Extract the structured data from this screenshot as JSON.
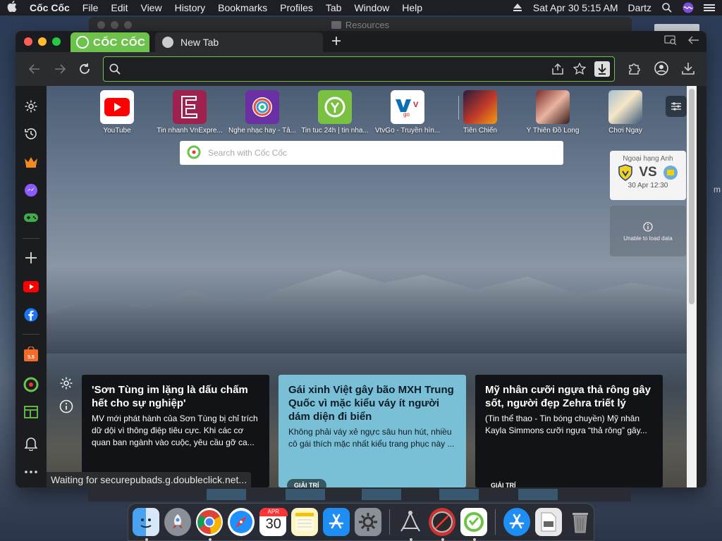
{
  "menubar": {
    "app": "Cốc Cốc",
    "items": [
      "File",
      "Edit",
      "View",
      "History",
      "Bookmarks",
      "Profiles",
      "Tab",
      "Window",
      "Help"
    ],
    "datetime": "Sat Apr 30  5:15 AM",
    "user": "Dartz"
  },
  "bg_window": {
    "title": "Resources"
  },
  "browser": {
    "tabs": [
      {
        "label": "CỐC CỐC"
      },
      {
        "label": "New Tab"
      }
    ]
  },
  "tiles": [
    {
      "label": "YouTube",
      "icon": "youtube-icon",
      "color": "#ffffff"
    },
    {
      "label": "Tin nhanh VnExpre...",
      "icon": "vnexpress-icon",
      "color": "#9f224e"
    },
    {
      "label": "Nghe nhạc hay - Tả...",
      "icon": "music-icon",
      "color": "#6b2fa4"
    },
    {
      "label": "Tin tuc 24h | tin nha...",
      "icon": "news24h-icon",
      "color": "#7ac142"
    },
    {
      "label": "VtvGo - Truyền hìn...",
      "icon": "vtvgo-icon",
      "color": "#ffffff"
    },
    {
      "label": "Tiên Chiến",
      "icon": "game-tienchien-icon",
      "color": "#5a2a1a"
    },
    {
      "label": "Ỷ Thiên Đồ Long",
      "icon": "game-ythien-icon",
      "color": "#8a3a3a"
    },
    {
      "label": "Chơi Ngay",
      "icon": "game-choingay-icon",
      "color": "#6b8aa0"
    }
  ],
  "search": {
    "placeholder": "Search with Cốc Cốc"
  },
  "match": {
    "league": "Ngoại hạng Anh",
    "vs": "VS",
    "date": "30 Apr 12:30"
  },
  "nodata": {
    "text": "Unable to load data"
  },
  "news": [
    {
      "title": "'Sơn Tùng im lặng là dấu chấm hết cho sự nghiệp'",
      "summary": "MV mới phát hành của Sơn Tùng bị chỉ trích dữ dội vì thông điệp tiêu cực. Khi các cơ quan ban ngành vào cuộc, yêu cầu gỡ ca...",
      "category": ""
    },
    {
      "title": "Gái xinh Việt gây bão MXH Trung Quốc vì mặc kiểu váy ít người dám diện đi biển",
      "summary": "Không phải váy xẻ ngực sâu hun hút, nhiều cô gái thích mặc nhất kiểu trang phục này ...",
      "category": "GIẢI TRÍ"
    },
    {
      "title": "Mỹ nhân cưỡi ngựa thả rông gây sốt, người đẹp Zehra triết lý",
      "summary": "(Tin thể thao - Tin bóng chuyền) Mỹ nhân Kayla Simmons cưỡi ngựa “thả rông” gây...",
      "category": "GIẢI TRÍ"
    }
  ],
  "status": {
    "text": "Waiting for securepubads.g.doubleclick.net..."
  },
  "calendar": {
    "month": "APR",
    "day": "30"
  },
  "side_text": "m"
}
